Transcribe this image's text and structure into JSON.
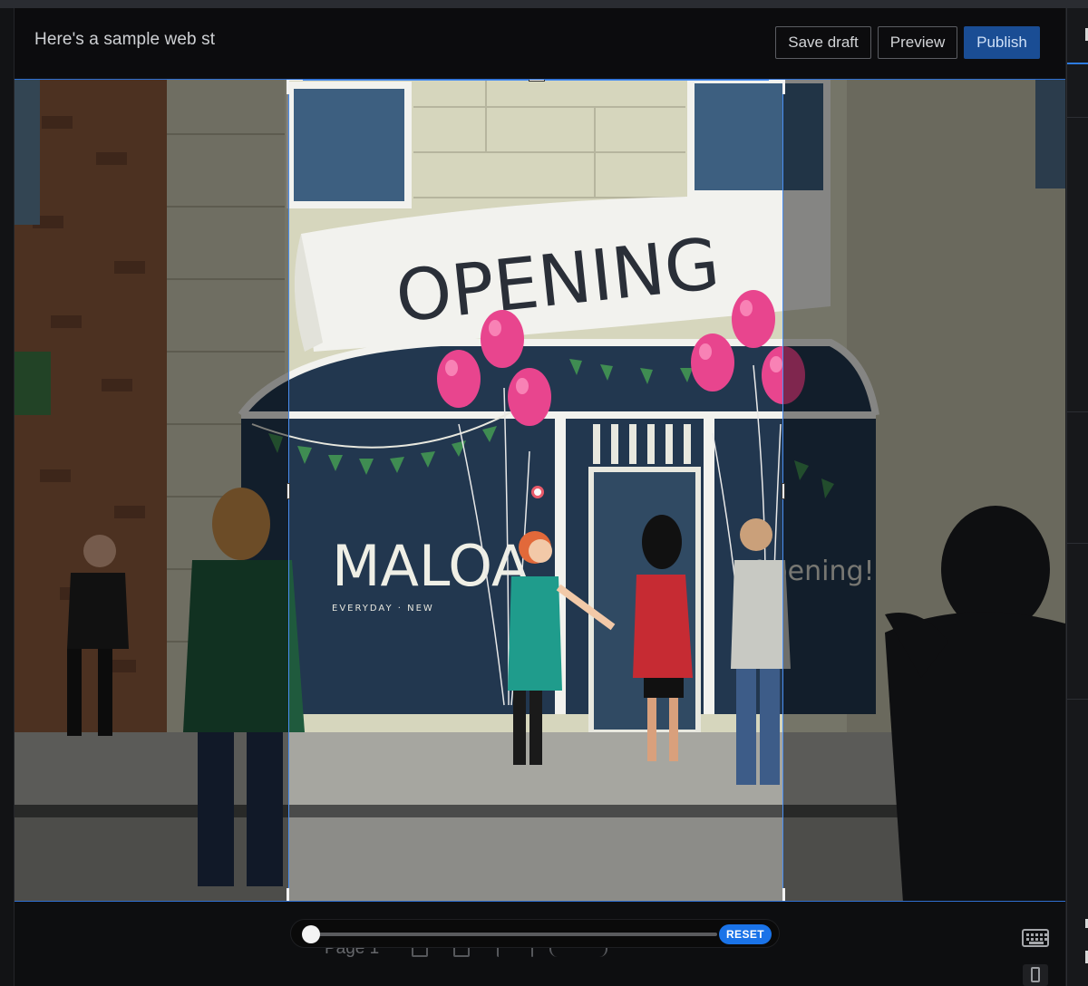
{
  "header": {
    "doc_title": "Here's a sample web st",
    "save_label": "Save draft",
    "preview_label": "Preview",
    "publish_label": "Publish"
  },
  "artwork": {
    "banner_text": "OPENING",
    "shop_name": "MALOA",
    "shop_subtitle": "EVERYDAY · NEW",
    "window_text": "Opening!"
  },
  "toolbar": {
    "page_label": "Page 1",
    "reset_label": "RESET",
    "zoom_level": 0.0
  },
  "colors": {
    "accent": "#1a73e8",
    "publish": "#1a4d94",
    "crop_border": "#4a8ef0",
    "balloon": "#e8458e"
  }
}
